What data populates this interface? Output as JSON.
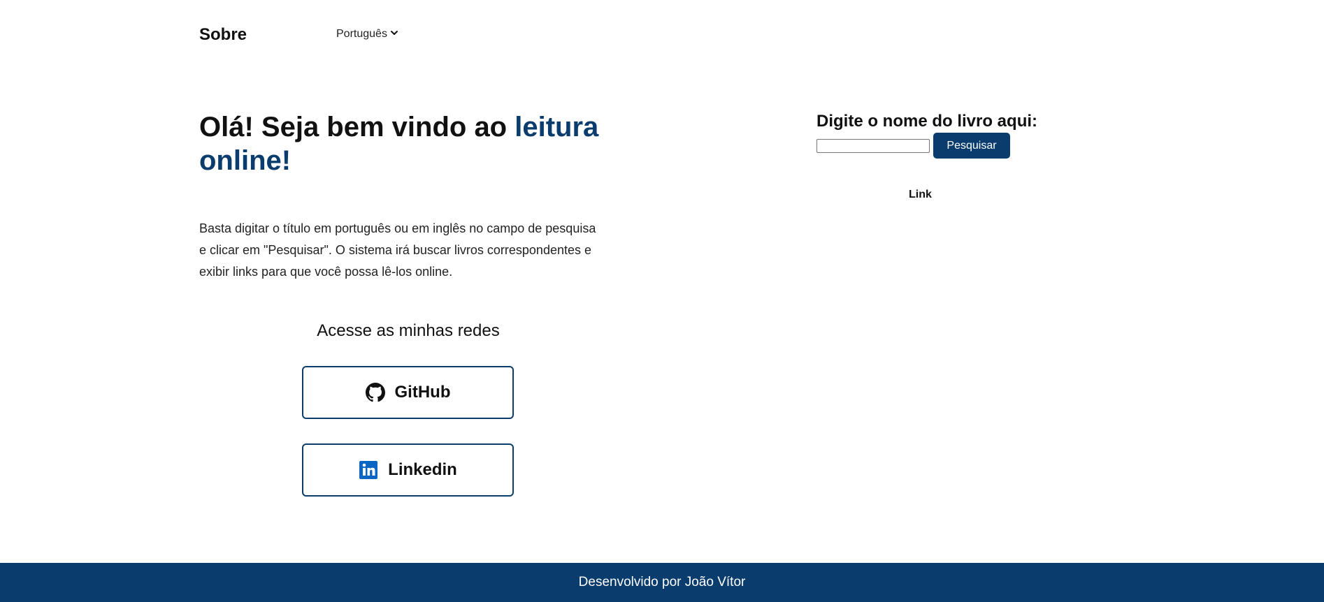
{
  "header": {
    "title": "Sobre",
    "language_select": {
      "selected": "Português",
      "icon": "chevron-down-icon"
    }
  },
  "hero": {
    "title_part1": "Olá! Seja bem vindo ao ",
    "title_accent": "leitura online!",
    "description": "Basta digitar o título em português ou em inglês no campo de pesquisa e clicar em \"Pesquisar\". O sistema irá buscar livros correspondentes e exibir links para que você possa lê-los online."
  },
  "social": {
    "heading": "Acesse as minhas redes",
    "buttons": [
      {
        "label": "GitHub",
        "icon": "github-icon"
      },
      {
        "label": "Linkedin",
        "icon": "linkedin-icon"
      }
    ]
  },
  "search": {
    "label": "Digite o nome do livro aqui:",
    "input_value": "",
    "button_label": "Pesquisar",
    "result_link": "Link"
  },
  "footer": {
    "text": "Desenvolvido por João Vítor"
  },
  "colors": {
    "primary": "#0a3d6e",
    "text": "#111111",
    "background": "#ffffff",
    "linkedin": "#0a66c2"
  }
}
